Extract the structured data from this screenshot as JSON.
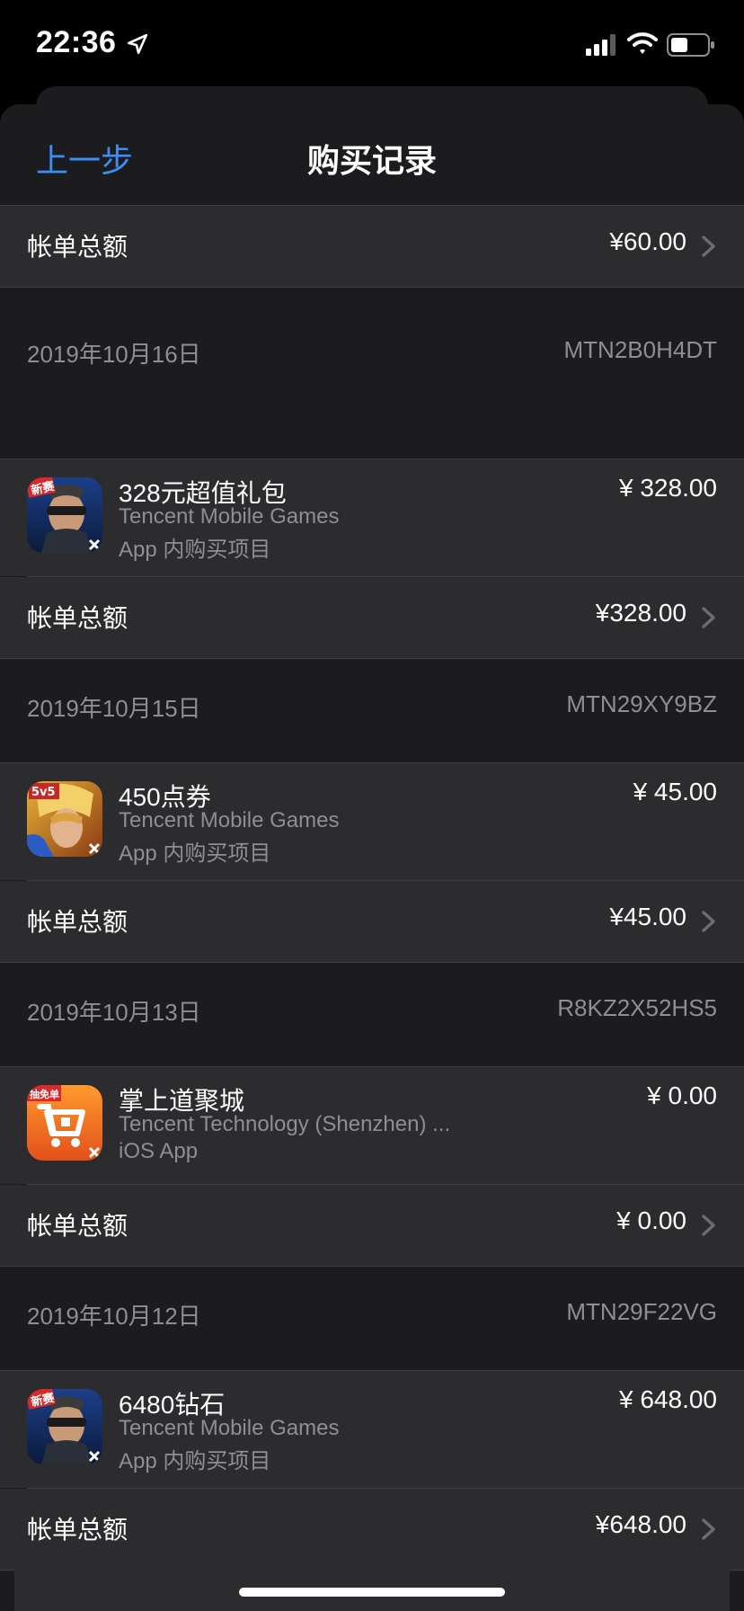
{
  "status_bar": {
    "time": "22:36",
    "icons": [
      "location-arrow-icon",
      "signal-icon",
      "wifi-icon",
      "battery-icon"
    ]
  },
  "nav": {
    "back_label": "上一步",
    "title": "购买记录"
  },
  "colors": {
    "accent": "#3a8ef6",
    "sheet_bg": "#1c1c1e",
    "cell_bg": "#2c2c2e",
    "secondary_text": "#8e8e93"
  },
  "top_total": {
    "label": "帐单总额",
    "amount": "¥60.00"
  },
  "purchases": [
    {
      "date": "2019年10月16日",
      "order_id": "MTN2B0H4DT",
      "item": {
        "name": "328元超值礼包",
        "developer": "Tencent Mobile Games",
        "kind": "App 内购买项目",
        "price": "¥ 328.00",
        "icon": "game-icon-soldier"
      },
      "total_label": "帐单总额",
      "total": "¥328.00"
    },
    {
      "date": "2019年10月15日",
      "order_id": "MTN29XY9BZ",
      "item": {
        "name": "450点券",
        "developer": "Tencent Mobile Games",
        "kind": "App 内购买项目",
        "price": "¥ 45.00",
        "icon": "game-icon-5v5-hero"
      },
      "total_label": "帐单总额",
      "total": "¥45.00"
    },
    {
      "date": "2019年10月13日",
      "order_id": "R8KZ2X52HS5",
      "item": {
        "name": "掌上道聚城",
        "developer": "Tencent Technology (Shenzhen) ...",
        "kind": "iOS App",
        "price": "¥ 0.00",
        "icon": "app-icon-cart"
      },
      "total_label": "帐单总额",
      "total": "¥ 0.00"
    },
    {
      "date": "2019年10月12日",
      "order_id": "MTN29F22VG",
      "item": {
        "name": "6480钻石",
        "developer": "Tencent Mobile Games",
        "kind": "App 内购买项目",
        "price": "¥ 648.00",
        "icon": "game-icon-soldier"
      },
      "total_label": "帐单总额",
      "total": "¥648.00"
    }
  ],
  "icon_badges": {
    "new_season": "新赛",
    "five_v_five": "5v5",
    "lottery": "抽免单"
  }
}
